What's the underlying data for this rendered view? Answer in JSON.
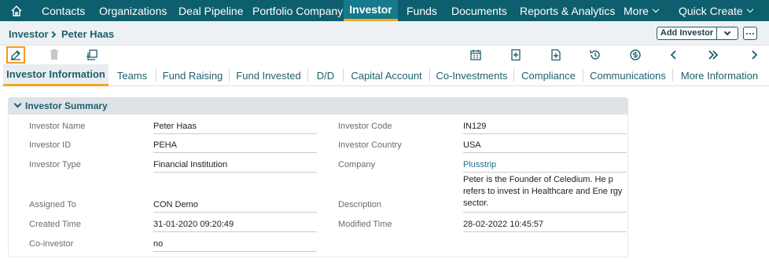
{
  "nav": {
    "items": [
      {
        "label": "Contacts"
      },
      {
        "label": "Organizations"
      },
      {
        "label": "Deal Pipeline"
      },
      {
        "label": "Portfolio Company"
      },
      {
        "label": "Investor"
      },
      {
        "label": "Funds"
      },
      {
        "label": "Documents"
      },
      {
        "label": "Reports & Analytics"
      },
      {
        "label": "More"
      },
      {
        "label": "Quick Create"
      }
    ],
    "active": "Investor"
  },
  "breadcrumb": {
    "module": "Investor",
    "record": "Peter Haas"
  },
  "header": {
    "add_label": "Add Investor"
  },
  "toolbar": {
    "icons": [
      "edit-icon",
      "trash-icon",
      "duplicate-icon",
      "calendar-icon",
      "add-note-icon",
      "add-document-icon",
      "history-icon",
      "currency-icon",
      "previous-icon",
      "fast-forward-icon",
      "next-icon"
    ]
  },
  "tabs": [
    {
      "label": "Investor Information"
    },
    {
      "label": "Teams"
    },
    {
      "label": "Fund Raising"
    },
    {
      "label": "Fund Invested"
    },
    {
      "label": "D/D"
    },
    {
      "label": "Capital Account"
    },
    {
      "label": "Co-Investments"
    },
    {
      "label": "Compliance"
    },
    {
      "label": "Communications"
    },
    {
      "label": "More Information"
    }
  ],
  "summary": {
    "title": "Investor Summary",
    "left": [
      {
        "label": "Investor Name",
        "value": "Peter Haas"
      },
      {
        "label": "Investor ID",
        "value": "PEHA"
      },
      {
        "label": "Investor Type",
        "value": "Financial Institution"
      },
      {
        "label": "Assigned To",
        "value": "CON Demo"
      },
      {
        "label": "Created Time",
        "value": "31-01-2020 09:20:49"
      },
      {
        "label": "Co-investor",
        "value": "no"
      }
    ],
    "right": [
      {
        "label": "Investor Code",
        "value": "IN129"
      },
      {
        "label": "Investor Country",
        "value": "USA"
      },
      {
        "label": "Company",
        "value": "Plusstrip"
      },
      {
        "label": "Description",
        "value": "Peter is the Founder of Celedium. He p refers to invest in Healthcare and Ene rgy sector."
      },
      {
        "label": "Modified Time",
        "value": "28-02-2022 10:45:57"
      }
    ]
  },
  "colors": {
    "nav_bg": "#0d5f6e",
    "accent": "#f5a623",
    "text_primary": "#1d5f6e"
  }
}
